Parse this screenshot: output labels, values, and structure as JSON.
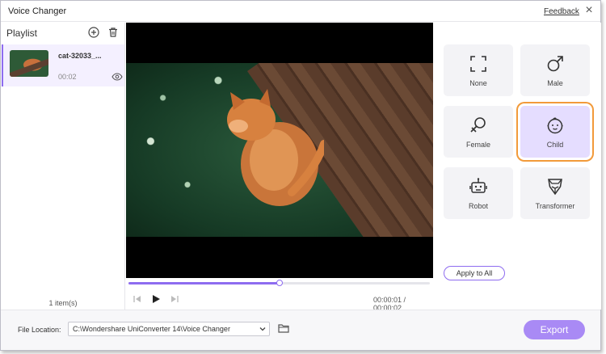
{
  "window": {
    "title": "Voice Changer",
    "feedback": "Feedback",
    "close_icon": "×"
  },
  "playlist": {
    "title": "Playlist",
    "items": [
      {
        "name": "cat-32033_...",
        "duration": "00:02"
      }
    ],
    "count": "1 item(s)"
  },
  "player": {
    "time": "00:00:01 / 00:00:02",
    "progress": 0.5
  },
  "effects": {
    "items": [
      {
        "label": "None",
        "icon": "fullscreen-frame-icon"
      },
      {
        "label": "Male",
        "icon": "male-symbol-icon"
      },
      {
        "label": "Female",
        "icon": "female-symbol-icon"
      },
      {
        "label": "Child",
        "icon": "child-face-icon",
        "selected": true
      },
      {
        "label": "Robot",
        "icon": "robot-icon"
      },
      {
        "label": "Transformer",
        "icon": "transformer-icon"
      }
    ],
    "apply_all": "Apply to All"
  },
  "footer": {
    "file_location_label": "File Location:",
    "file_location_value": "C:\\Wondershare UniConverter 14\\Voice Changer",
    "export": "Export"
  },
  "colors": {
    "accent": "#8e6cf0",
    "selected_outline": "#f29a3a",
    "export_bg": "#a98af5"
  }
}
